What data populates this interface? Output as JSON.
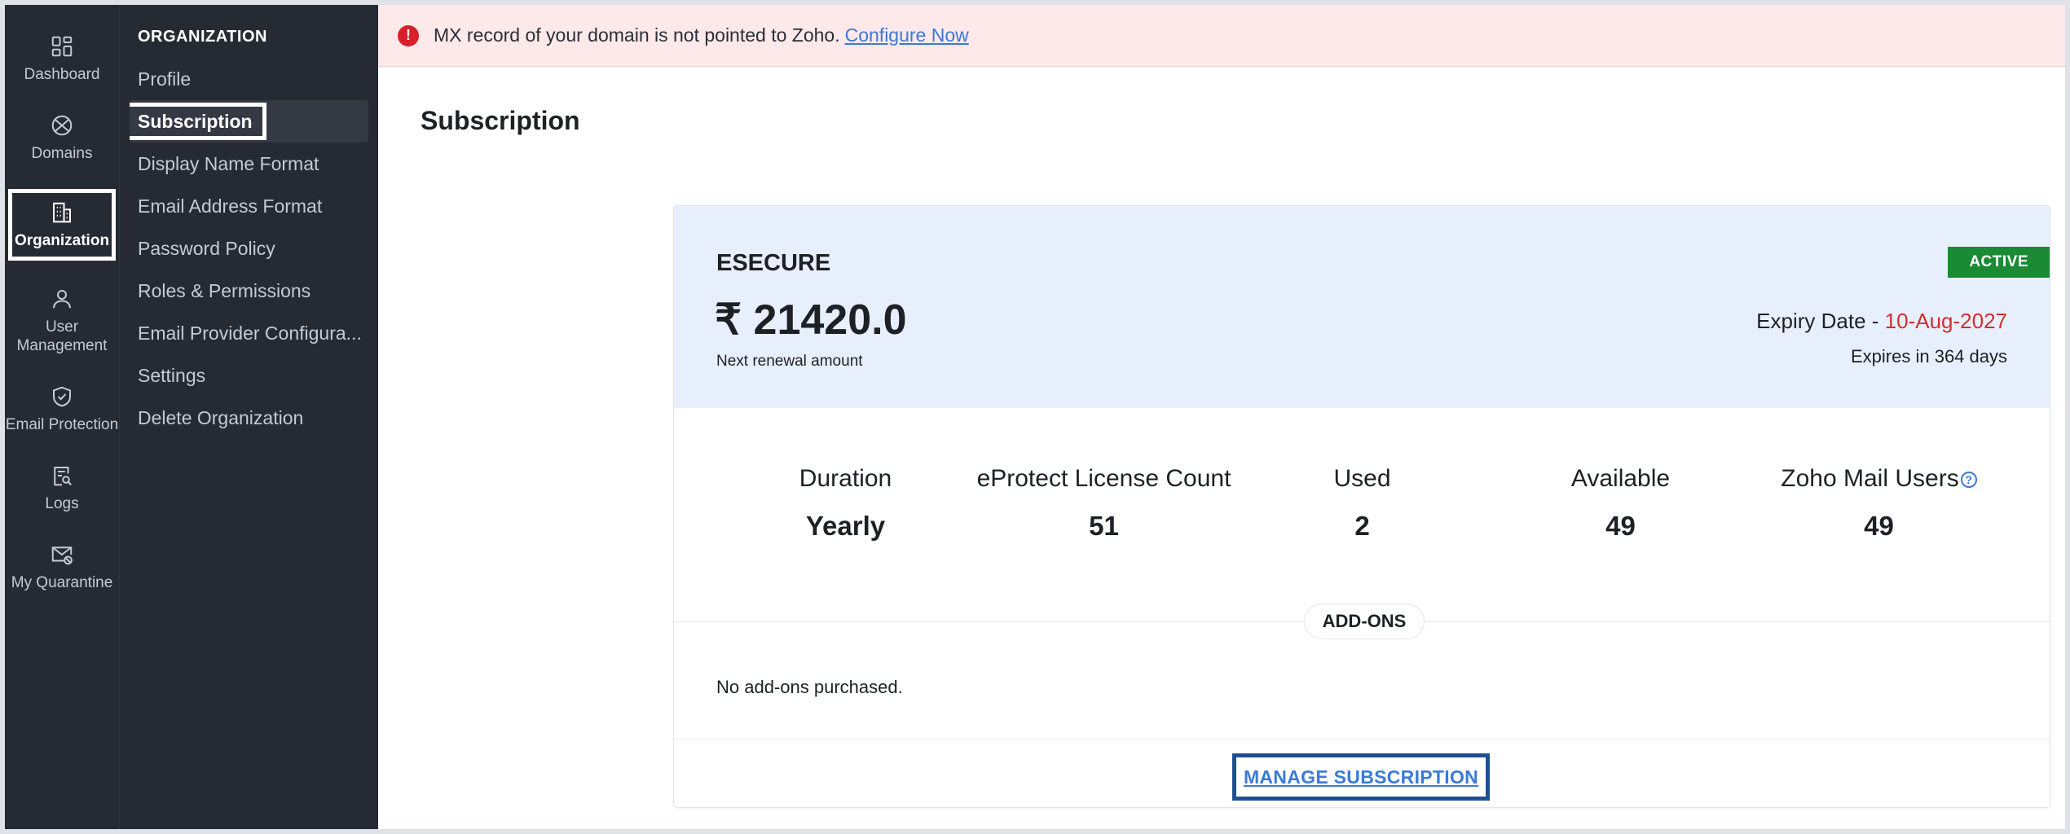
{
  "rail": {
    "items": [
      {
        "label": "Dashboard",
        "icon": "grid-icon"
      },
      {
        "label": "Domains",
        "icon": "globe-icon"
      },
      {
        "label": "Organization",
        "icon": "building-icon"
      },
      {
        "label": "User Management",
        "icon": "user-icon"
      },
      {
        "label": "Email Protection",
        "icon": "shield-check-icon"
      },
      {
        "label": "Logs",
        "icon": "log-search-icon"
      },
      {
        "label": "My Quarantine",
        "icon": "mail-blocked-icon"
      }
    ]
  },
  "subnav": {
    "heading": "ORGANIZATION",
    "items": [
      "Profile",
      "Subscription",
      "Display Name Format",
      "Email Address Format",
      "Password Policy",
      "Roles & Permissions",
      "Email Provider Configura...",
      "Settings",
      "Delete Organization"
    ]
  },
  "banner": {
    "message": "MX record of your domain is not pointed to Zoho.",
    "link": "Configure Now",
    "icon": "alert-icon"
  },
  "page": {
    "title": "Subscription"
  },
  "plan": {
    "name": "ESECURE",
    "amount": "₹ 21420.0",
    "amount_label": "Next renewal amount",
    "status": "ACTIVE",
    "expiry_label": "Expiry Date -",
    "expiry_date": "10-Aug-2027",
    "expires_in": "Expires in 364 days"
  },
  "stats": [
    {
      "label": "Duration",
      "value": "Yearly"
    },
    {
      "label": "eProtect License Count",
      "value": "51"
    },
    {
      "label": "Used",
      "value": "2"
    },
    {
      "label": "Available",
      "value": "49"
    },
    {
      "label": "Zoho Mail Users",
      "value": "49"
    }
  ],
  "addons": {
    "heading": "ADD-ONS",
    "empty_text": "No add-ons purchased."
  },
  "actions": {
    "manage": "MANAGE SUBSCRIPTION"
  },
  "colors": {
    "sidebar_bg": "#262a33",
    "banner_bg": "#fde8ea",
    "card_header_bg": "#e8effc",
    "active_badge": "#1a8a34",
    "expiry_red": "#d32f2f",
    "link_blue": "#3b7ad8"
  }
}
